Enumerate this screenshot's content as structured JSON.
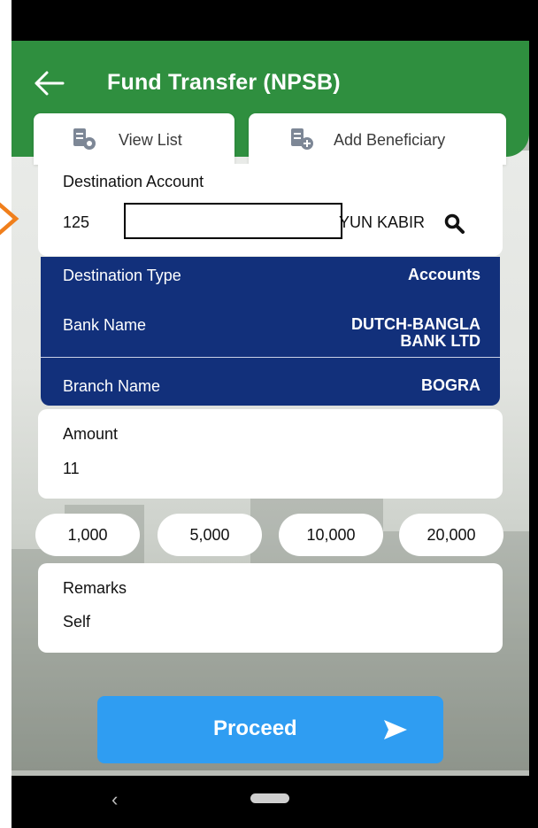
{
  "header": {
    "title": "Fund Transfer (NPSB)",
    "back_icon": "arrow-left-icon",
    "color": "#2f8f3f"
  },
  "tabs": [
    {
      "label": "View List",
      "icon": "list-search-icon"
    },
    {
      "label": "Add Beneficiary",
      "icon": "list-add-icon"
    }
  ],
  "destination": {
    "label": "Destination Account",
    "value_prefix": "125",
    "value_suffix": "YUN KABIR",
    "search_icon": "search-icon"
  },
  "details": {
    "color": "#12307b",
    "rows": [
      {
        "key": "Destination Type",
        "value": "Accounts"
      },
      {
        "key": "Bank Name",
        "value_line1": "DUTCH-BANGLA",
        "value_line2": "BANK LTD"
      },
      {
        "key": "Branch Name",
        "value": "BOGRA"
      }
    ]
  },
  "amount": {
    "label": "Amount",
    "value": "11"
  },
  "quick_amounts": [
    "1,000",
    "5,000",
    "10,000",
    "20,000"
  ],
  "remarks": {
    "label": "Remarks",
    "value": "Self"
  },
  "proceed": {
    "label": "Proceed",
    "icon": "send-icon",
    "color": "#2f9df2"
  },
  "nav": {
    "back": "‹"
  }
}
